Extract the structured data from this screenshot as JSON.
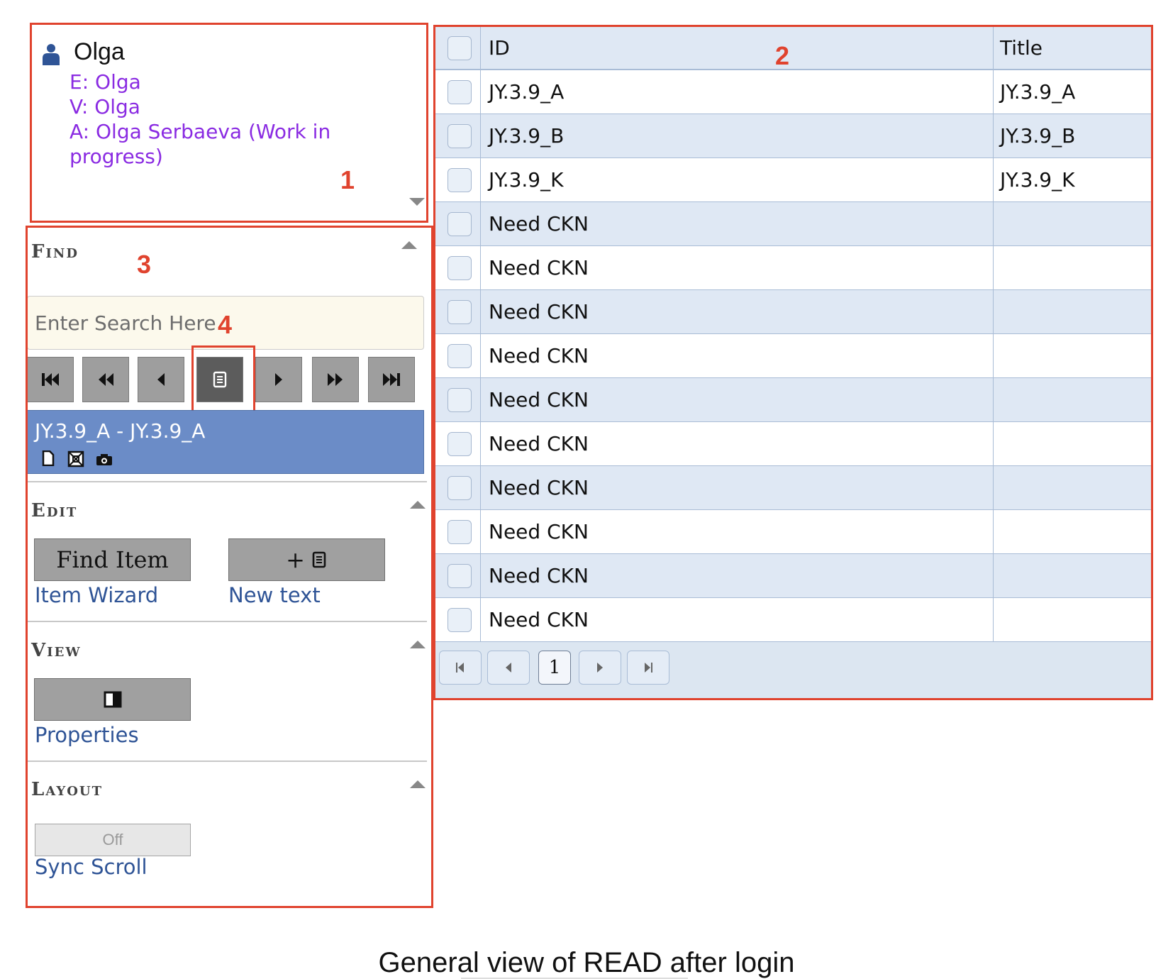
{
  "user": {
    "name": "Olga",
    "e_line": "E: Olga",
    "v_line": "V: Olga",
    "a_line": "A: Olga Serbaeva (Work in progress)"
  },
  "annotations": {
    "a1": "1",
    "a2": "2",
    "a3": "3",
    "a4": "4"
  },
  "find": {
    "title": "Find",
    "search_placeholder": "Enter Search Here",
    "nav_buttons": [
      "first-icon",
      "rewind-icon",
      "prev-icon",
      "scroll-icon",
      "next-icon",
      "fast-forward-icon",
      "last-icon"
    ],
    "selected_item": "JY.3.9_A - JY.3.9_A",
    "item_icons": [
      "document-icon",
      "image-box-icon",
      "camera-icon"
    ]
  },
  "edit": {
    "title": "Edit",
    "find_item_button": "Find Item",
    "item_wizard_label": "Item Wizard",
    "new_text_button": "+",
    "new_text_label": "New text"
  },
  "view": {
    "title": "View",
    "properties_label": "Properties"
  },
  "layout": {
    "title": "Layout",
    "sync_toggle": "Off",
    "sync_scroll_label": "Sync Scroll"
  },
  "grid": {
    "columns": [
      "ID",
      "Title"
    ],
    "rows": [
      {
        "id": "JY.3.9_A",
        "title": "JY.3.9_A"
      },
      {
        "id": "JY.3.9_B",
        "title": "JY.3.9_B"
      },
      {
        "id": "JY.3.9_K",
        "title": "JY.3.9_K"
      },
      {
        "id": "Need CKN",
        "title": ""
      },
      {
        "id": "Need CKN",
        "title": ""
      },
      {
        "id": "Need CKN",
        "title": ""
      },
      {
        "id": "Need CKN",
        "title": ""
      },
      {
        "id": "Need CKN",
        "title": ""
      },
      {
        "id": "Need CKN",
        "title": ""
      },
      {
        "id": "Need CKN",
        "title": ""
      },
      {
        "id": "Need CKN",
        "title": ""
      },
      {
        "id": "Need CKN",
        "title": ""
      },
      {
        "id": "Need CKN",
        "title": ""
      }
    ],
    "pager_page": "1"
  },
  "caption": {
    "before": "General ",
    "underlined": "view",
    "after": " of READ after login"
  },
  "colors": {
    "annotation": "#e0432e",
    "user_meta": "#8a2be2",
    "link": "#2f5496",
    "selected": "#6b8cc7",
    "grid_bg": "#dce6f1"
  }
}
